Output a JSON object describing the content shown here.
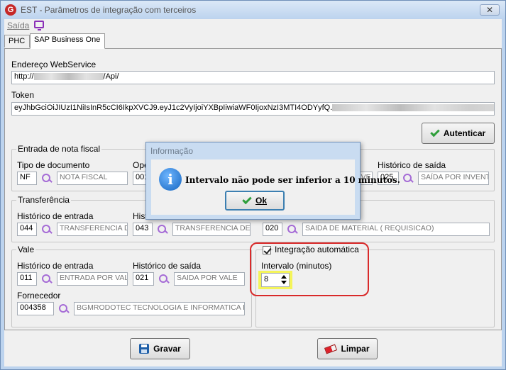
{
  "window": {
    "title": "EST - Parâmetros de integração com terceiros",
    "close_label": "✕",
    "logo": "G"
  },
  "menu": {
    "exit_label": "Saída",
    "icon": "monitor-icon"
  },
  "tabs": [
    {
      "label": "PHC"
    },
    {
      "label": "SAP Business One"
    }
  ],
  "webservice": {
    "label": "Endereço WebService",
    "value_prefix": "http://",
    "value_suffix": "/Api/"
  },
  "token": {
    "label": "Token",
    "value": "eyJhbGciOiJIUzI1NiIsInR5cCI6IkpXVCJ9.eyJ1c2VyIjoiYXBpIiwiaWF0IjoxNzI3MTI4ODYyfQ."
  },
  "authenticate_button": "Autenticar",
  "entrada_nota": {
    "title": "Entrada de nota fiscal",
    "tipo_label": "Tipo de documento",
    "tipo_code": "NF",
    "tipo_desc": "NOTA FISCAL",
    "operacao_label_partial": "Ope",
    "operacao_code_partial": "001",
    "middle_desc_partial": "NVE",
    "historico_saida_label": "Histórico de saída",
    "historico_saida_code": "025",
    "historico_saida_desc": "SAÍDA POR INVENT"
  },
  "transferencia": {
    "title": "Transferência",
    "hist_entrada_label": "Histórico de entrada",
    "hist_entrada_code": "044",
    "hist_entrada_desc": "TRANSFERENCIA DE",
    "hist_saida_label_partial": "Hist",
    "hist_saida_code_partial": "043",
    "hist_saida_desc_partial": "TRANSFERENCIA DE",
    "right_code_partial": "020",
    "right_desc": "SAIDA DE MATERIAL ( REQUISICAO)"
  },
  "vale": {
    "title": "Vale",
    "hist_entrada_label": "Histórico de entrada",
    "hist_entrada_code": "011",
    "hist_entrada_desc": "ENTRADA POR VALE",
    "hist_saida_label": "Histórico de saída",
    "hist_saida_code": "021",
    "hist_saida_desc": "SAIDA POR VALE",
    "fornecedor_label": "Fornecedor",
    "fornecedor_code": "004358",
    "fornecedor_desc": "BGMRODOTEC TECNOLOGIA E INFORMATICA LT"
  },
  "integracao": {
    "checkbox_label": "Integração automática",
    "checked": true,
    "intervalo_label": "Intervalo (minutos)",
    "intervalo_value": "8"
  },
  "buttons": {
    "save": "Gravar",
    "clear": "Limpar"
  },
  "dialog": {
    "title": "Informação",
    "message": "Intervalo não pode ser inferior a 10 minutos.",
    "ok_label": "Ok",
    "info_glyph": "i"
  },
  "colors": {
    "annotation_red": "#d92a2a",
    "highlight_yellow": "#f4f45a",
    "accent_purple": "#a56bd6"
  }
}
